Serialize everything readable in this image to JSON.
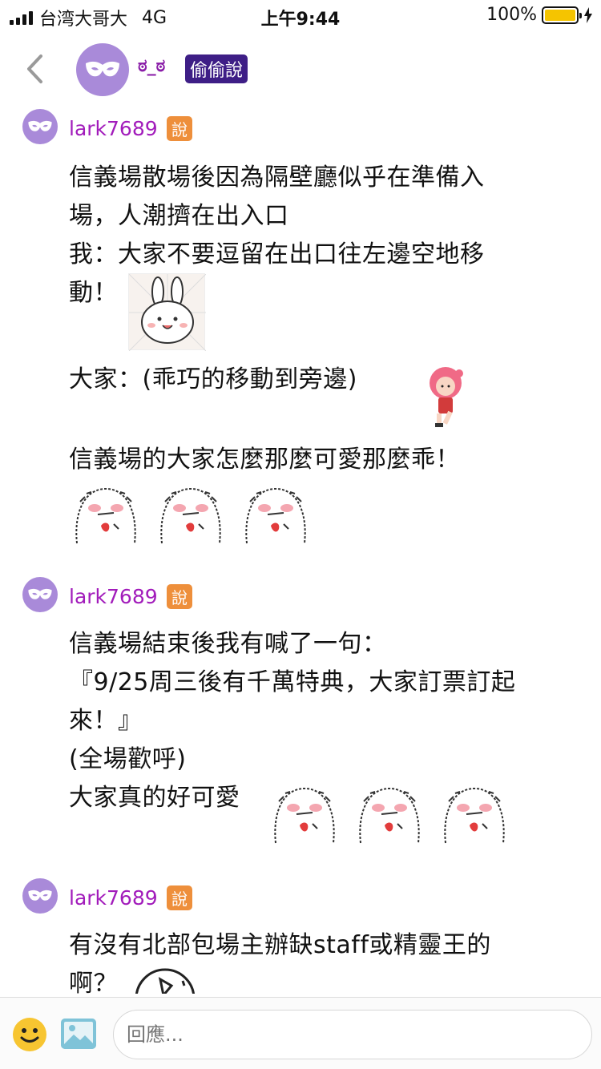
{
  "status_bar": {
    "carrier": "台湾大哥大",
    "network": "4G",
    "time": "上午9:44",
    "battery": "100%",
    "battery_level": 1.0,
    "battery_color": "#f5c400"
  },
  "header": {
    "title": "ಠ_ಠ",
    "board_badge": "偷偷說",
    "accent": "#8a1da8",
    "badge_bg": "#3e1e86"
  },
  "posts": [
    {
      "user": "lark7689",
      "badge": "說",
      "lines": [
        "信義場散場後因為隔壁廳似乎在準備入",
        "場，人潮擠在出入口",
        "我：大家不要逗留在出口往左邊空地移",
        "動！",
        "大家：(乖巧的移動到旁邊)",
        "信義場的大家怎麼那麼可愛那麼乖！"
      ]
    },
    {
      "user": "lark7689",
      "badge": "說",
      "lines": [
        "信義場結束後我有喊了一句：",
        "『9/25周三後有千萬特典，大家訂票訂起",
        "來！』",
        "(全場歡呼)",
        "大家真的好可愛"
      ]
    },
    {
      "user": "lark7689",
      "badge": "說",
      "lines": [
        "有沒有北部包場主辦缺staff或精靈王的",
        "啊？"
      ]
    }
  ],
  "reply": {
    "placeholder": "回應..."
  },
  "icons": {
    "back": "chevron-left-icon",
    "avatar": "mask-icon",
    "emoji": "smiley-icon",
    "image": "image-icon"
  }
}
